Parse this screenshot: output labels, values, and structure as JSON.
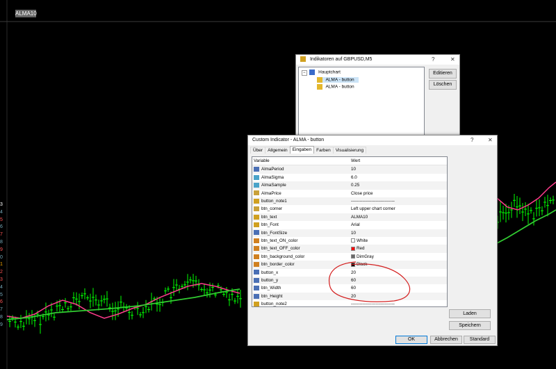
{
  "chart": {
    "button_text": "ALMA10",
    "left_scale": [
      "3",
      "4",
      "5",
      "6",
      "7",
      "8",
      "9",
      "0",
      "1",
      "2",
      "3",
      "4",
      "5",
      "6",
      "7",
      "8",
      "9"
    ],
    "colors": {
      "background": "#000000",
      "candles": "#00ff00",
      "ma_line": "#ff3c8c",
      "signal_line": "#32cd32"
    }
  },
  "indicators_dialog": {
    "title": "Indikatoren auf GBPUSD,M5",
    "help": "?",
    "close": "✕",
    "tree": {
      "root": "Hauptchart",
      "items": [
        "ALMA  - button",
        "ALMA  - button"
      ]
    },
    "buttons": {
      "edit": "Editieren",
      "delete": "Löschen"
    }
  },
  "custom_dialog": {
    "title": "Custom Indicator - ALMA  - button",
    "help": "?",
    "close": "✕",
    "tabs": [
      "Über",
      "Allgemein",
      "Eingaben",
      "Farben",
      "Visualisierung"
    ],
    "active_tab": "Eingaben",
    "columns": {
      "variable": "Variable",
      "value": "Wert"
    },
    "rows": [
      {
        "name": "AlmaPeriod",
        "value": "10",
        "icon": "int"
      },
      {
        "name": "AlmaSigma",
        "value": "6.0",
        "icon": "double"
      },
      {
        "name": "AlmaSample",
        "value": "0.25",
        "icon": "double"
      },
      {
        "name": "AlmaPrice",
        "value": "Close price",
        "icon": "enum"
      },
      {
        "name": "button_note1",
        "value": "------------------------------",
        "icon": "string"
      },
      {
        "name": "btn_corner",
        "value": "Left upper chart corner",
        "icon": "enum"
      },
      {
        "name": "btn_text",
        "value": "ALMA10",
        "icon": "string"
      },
      {
        "name": "btn_Font",
        "value": "Arial",
        "icon": "string"
      },
      {
        "name": "btn_FontSize",
        "value": "10",
        "icon": "int"
      },
      {
        "name": "btn_text_ON_color",
        "value": "White",
        "icon": "color",
        "swatch": "#ffffff"
      },
      {
        "name": "btn_text_OFF_color",
        "value": "Red",
        "icon": "color",
        "swatch": "#ff0000"
      },
      {
        "name": "btn_background_color",
        "value": "DimGray",
        "icon": "color",
        "swatch": "#696969"
      },
      {
        "name": "btn_border_color",
        "value": "Black",
        "icon": "color",
        "swatch": "#000000"
      },
      {
        "name": "button_x",
        "value": "20",
        "icon": "int"
      },
      {
        "name": "button_y",
        "value": "60",
        "icon": "int"
      },
      {
        "name": "btn_Width",
        "value": "60",
        "icon": "int"
      },
      {
        "name": "btn_Height",
        "value": "20",
        "icon": "int"
      },
      {
        "name": "button_note2",
        "value": "------------------------------",
        "icon": "string"
      }
    ],
    "buttons": {
      "load": "Laden",
      "save": "Speichern",
      "ok": "OK",
      "cancel": "Abbrechen",
      "default": "Standard"
    },
    "annotation_color": "#d42020"
  }
}
